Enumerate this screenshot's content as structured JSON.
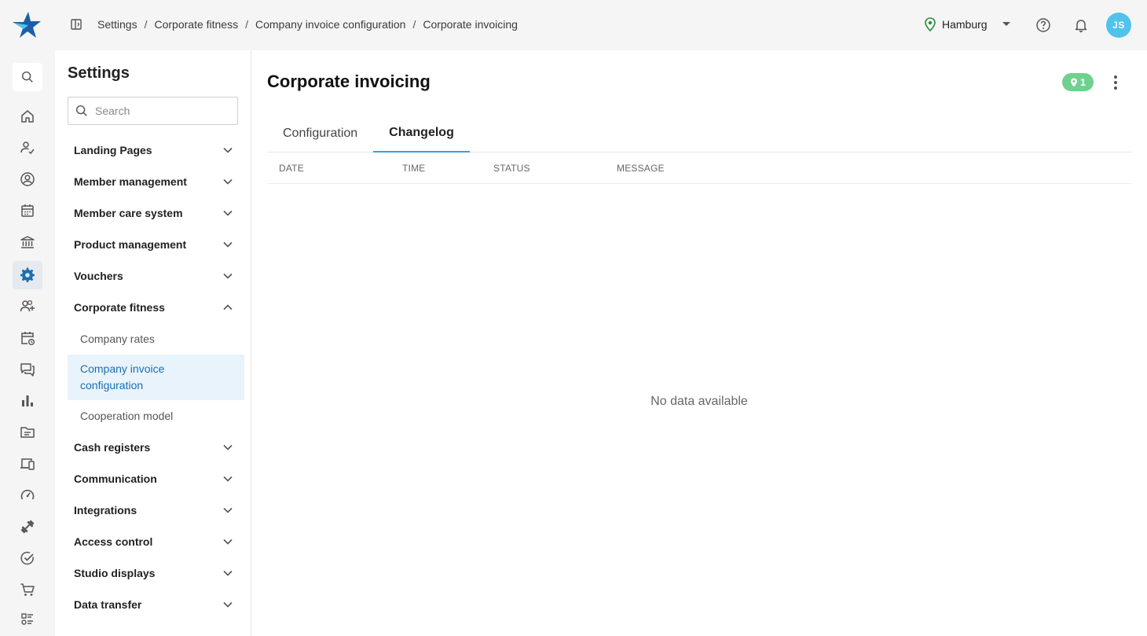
{
  "breadcrumb": [
    "Settings",
    "Corporate fitness",
    "Company invoice configuration",
    "Corporate invoicing"
  ],
  "header": {
    "location": "Hamburg",
    "avatar_initials": "JS"
  },
  "colors": {
    "brand": "#1c5fa8",
    "accent": "#3aa0dc",
    "badge": "#6fd18e",
    "avatar": "#4fc3ec"
  },
  "rail": {
    "items": [
      "search-icon",
      "home-icon",
      "member-check-icon",
      "account-icon",
      "calendar-icon",
      "bank-icon",
      "settings-icon",
      "add-person-icon",
      "calendar-sync-icon",
      "chat-icon",
      "bar-chart-icon",
      "folder-icon",
      "devices-icon",
      "speedometer-icon",
      "dumbbell-icon",
      "check-circle-icon",
      "cart-icon",
      "list-icon"
    ],
    "active": "settings-icon"
  },
  "settings": {
    "title": "Settings",
    "search_placeholder": "Search",
    "items": [
      {
        "label": "Landing Pages",
        "expanded": false
      },
      {
        "label": "Member management",
        "expanded": false
      },
      {
        "label": "Member care system",
        "expanded": false
      },
      {
        "label": "Product management",
        "expanded": false
      },
      {
        "label": "Vouchers",
        "expanded": false
      },
      {
        "label": "Corporate fitness",
        "expanded": true
      },
      {
        "label": "Cash registers",
        "expanded": false
      },
      {
        "label": "Communication",
        "expanded": false
      },
      {
        "label": "Integrations",
        "expanded": false
      },
      {
        "label": "Access control",
        "expanded": false
      },
      {
        "label": "Studio displays",
        "expanded": false
      },
      {
        "label": "Data transfer",
        "expanded": false
      }
    ],
    "subitems": [
      {
        "label": "Company rates",
        "active": false
      },
      {
        "label": "Company invoice configuration",
        "active": true
      },
      {
        "label": "Cooperation model",
        "active": false
      }
    ]
  },
  "main": {
    "title": "Corporate invoicing",
    "badge_count": "1",
    "tabs": [
      {
        "label": "Configuration",
        "active": false
      },
      {
        "label": "Changelog",
        "active": true
      }
    ],
    "columns": [
      "DATE",
      "TIME",
      "STATUS",
      "MESSAGE"
    ],
    "empty_text": "No data available"
  }
}
